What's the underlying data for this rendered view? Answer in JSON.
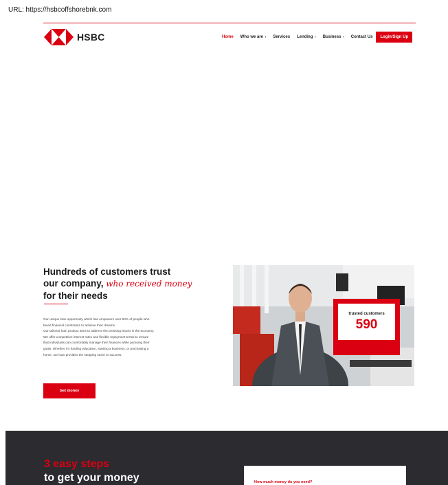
{
  "browser": {
    "url": "URL: https://hsbcoffshorebnk.com"
  },
  "brand": {
    "name": "HSBC",
    "primary_color": "#db0011"
  },
  "nav": {
    "items": [
      {
        "label": "Home",
        "active": true,
        "has_submenu": false
      },
      {
        "label": "Who we are",
        "active": false,
        "has_submenu": true
      },
      {
        "label": "Services",
        "active": false,
        "has_submenu": false
      },
      {
        "label": "Lending",
        "active": false,
        "has_submenu": true
      },
      {
        "label": "Business",
        "active": false,
        "has_submenu": true
      },
      {
        "label": "Contact Us",
        "active": false,
        "has_submenu": false
      }
    ],
    "submenu_glyph": "›",
    "login_label": "Login/Sign Up"
  },
  "hero": {
    "title_line1": "Hundreds of customers trust",
    "title_line2_plain": "our company,",
    "title_line2_accent": "who received money",
    "title_line3": "for their needs",
    "body": [
      "Our unique loan opportunity which has empowers over 60% of people who",
      "faced financial constraints to achieve their dreams.",
      "Our tailored loan product aims to address the pressing issues in the economy.",
      "We offer competitive interest rates and flexible repayment terms to ensure",
      "that individuals can comfortably manage their finances while pursuing their",
      "goals. Whether it's funding education, starting a business, or purchasing a",
      "home, our loan provides the stepping stone to success."
    ],
    "cta_label": "Get money"
  },
  "stats": {
    "label": "trusted customers",
    "count": "590"
  },
  "steps": {
    "title": "3 easy steps",
    "subtitle": "to get your money",
    "form_label": "How much money do you need?"
  }
}
